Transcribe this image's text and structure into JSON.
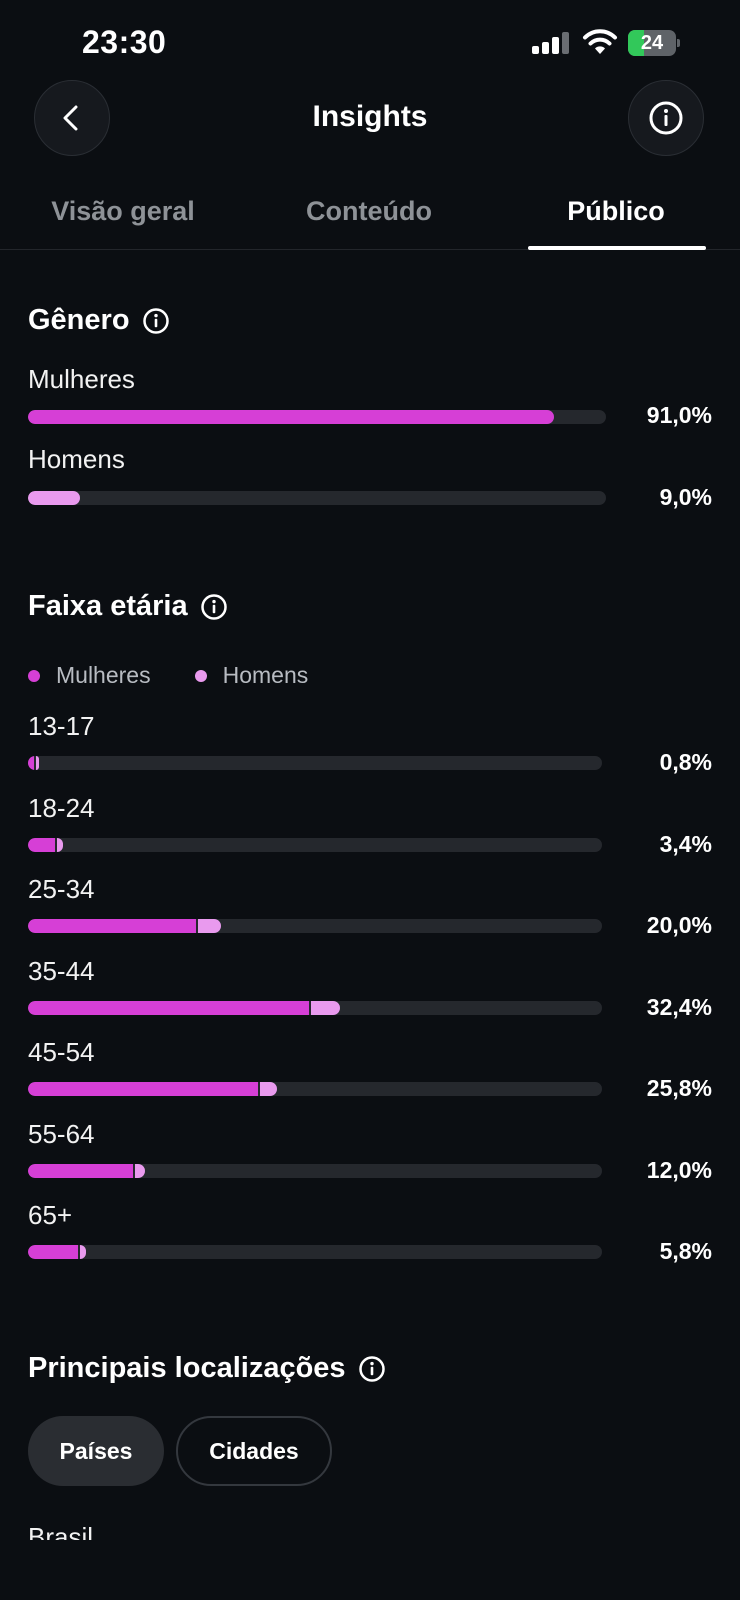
{
  "status_bar": {
    "time": "23:30",
    "battery": "24"
  },
  "header": {
    "title": "Insights",
    "back_icon": "chevron-left-icon",
    "info_icon": "info-icon"
  },
  "tabs": [
    {
      "label": "Visão geral",
      "active": false
    },
    {
      "label": "Conteúdo",
      "active": false
    },
    {
      "label": "Público",
      "active": true
    }
  ],
  "gender": {
    "title": "Gênero",
    "rows": [
      {
        "label": "Mulheres",
        "value": 91.0,
        "display": "91,0%",
        "color": "#d63fd6"
      },
      {
        "label": "Homens",
        "value": 9.0,
        "display": "9,0%",
        "color": "#e99aee"
      }
    ]
  },
  "age": {
    "title": "Faixa etária",
    "legend": [
      {
        "label": "Mulheres",
        "color": "#d63fd6"
      },
      {
        "label": "Homens",
        "color": "#e99aee"
      }
    ],
    "rows": [
      {
        "label": "13-17",
        "display": "0,8%",
        "total": 0.8,
        "women": 0.6,
        "men": 0.2
      },
      {
        "label": "18-24",
        "display": "3,4%",
        "total": 3.4,
        "women": 2.8,
        "men": 0.6
      },
      {
        "label": "25-34",
        "display": "20,0%",
        "total": 20.0,
        "women": 17.6,
        "men": 2.4
      },
      {
        "label": "35-44",
        "display": "32,4%",
        "total": 32.4,
        "women": 29.4,
        "men": 3.0
      },
      {
        "label": "45-54",
        "display": "25,8%",
        "total": 25.8,
        "women": 24.0,
        "men": 1.8
      },
      {
        "label": "55-64",
        "display": "12,0%",
        "total": 12.0,
        "women": 11.0,
        "men": 1.0
      },
      {
        "label": "65+",
        "display": "5,8%",
        "total": 5.8,
        "women": 5.2,
        "men": 0.6
      }
    ]
  },
  "locations": {
    "title": "Principais localizações",
    "pills": [
      {
        "label": "Países",
        "active": true
      },
      {
        "label": "Cidades",
        "active": false
      }
    ],
    "first_row": "Brasil"
  }
}
